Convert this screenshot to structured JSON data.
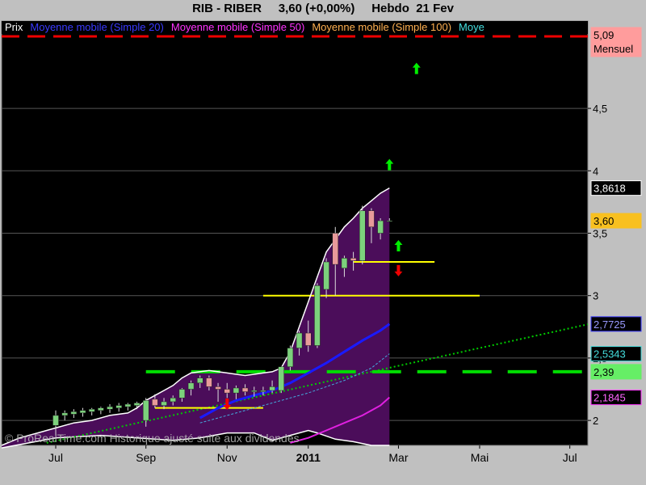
{
  "header": {
    "title": "RIB - RIBER     3,60 (+0,00%)     Hebdo  21 Fev"
  },
  "colors": {
    "background": "#c0c0c0",
    "plot_bg": "#000000",
    "fill_area": "#4b0d5a",
    "up_candle": "#7cd17c",
    "down_candle": "#e89a9a",
    "price_line": "#ffffff",
    "ma20": "#1a1aff",
    "ma50": "#e020e0",
    "ma100": "#ffb050",
    "trend": "#00cc00",
    "support": "#ffff00",
    "dashed": "#00dd00"
  },
  "chart_data": {
    "type": "candlestick",
    "title": "RIB - RIBER     3,60 (+0,00%)     Hebdo  21 Fev",
    "legend": [
      {
        "name": "Prix",
        "color": "#ffffff"
      },
      {
        "name": "Moyenne mobile (Simple 20)",
        "color": "#3a3aff"
      },
      {
        "name": "Moyenne mobile (Simple 50)",
        "color": "#ff33ff"
      },
      {
        "name": "Moyenne mobile (Simple 100)",
        "color": "#ffb050"
      },
      {
        "name": "Moye",
        "color": "#44dddd"
      }
    ],
    "x_ticks": [
      {
        "label": "Jul",
        "i": 0,
        "bold": false
      },
      {
        "label": "Sep",
        "i": 10,
        "bold": false
      },
      {
        "label": "Nov",
        "i": 19,
        "bold": false
      },
      {
        "label": "2011",
        "i": 28,
        "bold": true
      },
      {
        "label": "Mar",
        "i": 38,
        "bold": false
      },
      {
        "label": "Mai",
        "i": 47,
        "bold": false
      },
      {
        "label": "Jul",
        "i": 57,
        "bold": false
      }
    ],
    "y_ticks": [
      "2",
      "2,5",
      "3",
      "3,5",
      "4",
      "4,5"
    ],
    "y_tick_values": [
      2,
      2.5,
      3,
      3.5,
      4,
      4.5
    ],
    "ylim": [
      1.8,
      5.2
    ],
    "xlim": [
      -6,
      59
    ],
    "candles": [
      {
        "i": 0,
        "o": 1.96,
        "h": 2.08,
        "l": 1.88,
        "c": 2.04
      },
      {
        "i": 1,
        "o": 2.04,
        "h": 2.08,
        "l": 2.0,
        "c": 2.06
      },
      {
        "i": 2,
        "o": 2.05,
        "h": 2.09,
        "l": 2.02,
        "c": 2.07
      },
      {
        "i": 3,
        "o": 2.06,
        "h": 2.1,
        "l": 2.03,
        "c": 2.08
      },
      {
        "i": 4,
        "o": 2.07,
        "h": 2.1,
        "l": 2.04,
        "c": 2.09
      },
      {
        "i": 5,
        "o": 2.08,
        "h": 2.11,
        "l": 2.05,
        "c": 2.1
      },
      {
        "i": 6,
        "o": 2.09,
        "h": 2.13,
        "l": 2.06,
        "c": 2.11
      },
      {
        "i": 7,
        "o": 2.1,
        "h": 2.14,
        "l": 2.07,
        "c": 2.12
      },
      {
        "i": 8,
        "o": 2.11,
        "h": 2.14,
        "l": 2.08,
        "c": 2.13
      },
      {
        "i": 9,
        "o": 2.12,
        "h": 2.15,
        "l": 2.09,
        "c": 2.14
      },
      {
        "i": 10,
        "o": 2.0,
        "h": 2.18,
        "l": 1.95,
        "c": 2.16
      },
      {
        "i": 11,
        "o": 2.17,
        "h": 2.21,
        "l": 2.1,
        "c": 2.12
      },
      {
        "i": 12,
        "o": 2.12,
        "h": 2.18,
        "l": 2.09,
        "c": 2.15
      },
      {
        "i": 13,
        "o": 2.15,
        "h": 2.2,
        "l": 2.12,
        "c": 2.18
      },
      {
        "i": 14,
        "o": 2.18,
        "h": 2.26,
        "l": 2.15,
        "c": 2.25
      },
      {
        "i": 15,
        "o": 2.25,
        "h": 2.32,
        "l": 2.2,
        "c": 2.3
      },
      {
        "i": 16,
        "o": 2.3,
        "h": 2.36,
        "l": 2.26,
        "c": 2.34
      },
      {
        "i": 17,
        "o": 2.34,
        "h": 2.36,
        "l": 2.24,
        "c": 2.27
      },
      {
        "i": 18,
        "o": 2.27,
        "h": 2.3,
        "l": 2.15,
        "c": 2.25
      },
      {
        "i": 19,
        "o": 2.25,
        "h": 2.3,
        "l": 2.18,
        "c": 2.22
      },
      {
        "i": 20,
        "o": 2.22,
        "h": 2.28,
        "l": 2.17,
        "c": 2.26
      },
      {
        "i": 21,
        "o": 2.26,
        "h": 2.29,
        "l": 2.2,
        "c": 2.23
      },
      {
        "i": 22,
        "o": 2.23,
        "h": 2.27,
        "l": 2.19,
        "c": 2.24
      },
      {
        "i": 23,
        "o": 2.23,
        "h": 2.27,
        "l": 2.2,
        "c": 2.24
      },
      {
        "i": 24,
        "o": 2.24,
        "h": 2.32,
        "l": 2.22,
        "c": 2.27
      },
      {
        "i": 25,
        "o": 2.24,
        "h": 2.43,
        "l": 2.22,
        "c": 2.43
      },
      {
        "i": 26,
        "o": 2.43,
        "h": 2.6,
        "l": 2.4,
        "c": 2.58
      },
      {
        "i": 27,
        "o": 2.58,
        "h": 2.72,
        "l": 2.52,
        "c": 2.7
      },
      {
        "i": 28,
        "o": 2.7,
        "h": 2.8,
        "l": 2.55,
        "c": 2.6
      },
      {
        "i": 29,
        "o": 2.6,
        "h": 3.1,
        "l": 2.58,
        "c": 3.08
      },
      {
        "i": 30,
        "o": 3.05,
        "h": 3.3,
        "l": 2.98,
        "c": 3.27
      },
      {
        "i": 31,
        "o": 3.5,
        "h": 3.55,
        "l": 3.0,
        "c": 3.25
      },
      {
        "i": 32,
        "o": 3.22,
        "h": 3.32,
        "l": 3.15,
        "c": 3.3
      },
      {
        "i": 33,
        "o": 3.3,
        "h": 3.35,
        "l": 3.2,
        "c": 3.28
      },
      {
        "i": 34,
        "o": 3.28,
        "h": 3.72,
        "l": 3.25,
        "c": 3.68
      },
      {
        "i": 35,
        "o": 3.68,
        "h": 3.7,
        "l": 3.42,
        "c": 3.55
      },
      {
        "i": 36,
        "o": 3.5,
        "h": 3.62,
        "l": 3.45,
        "c": 3.6
      },
      {
        "i": 37,
        "o": 3.6,
        "h": 3.62,
        "l": 3.6,
        "c": 3.6
      }
    ],
    "price_line": [
      [
        -6,
        1.8
      ],
      [
        -4,
        1.86
      ],
      [
        -2,
        1.9
      ],
      [
        0,
        1.94
      ],
      [
        2,
        1.98
      ],
      [
        4,
        2.0
      ],
      [
        6,
        2.04
      ],
      [
        8,
        2.06
      ],
      [
        9,
        2.1
      ],
      [
        10,
        2.16
      ],
      [
        11,
        2.2
      ],
      [
        12,
        2.24
      ],
      [
        13,
        2.28
      ],
      [
        14,
        2.34
      ],
      [
        15,
        2.38
      ],
      [
        16,
        2.39
      ],
      [
        17,
        2.4
      ],
      [
        18,
        2.39
      ],
      [
        19,
        2.38
      ],
      [
        20,
        2.37
      ],
      [
        21,
        2.36
      ],
      [
        22,
        2.37
      ],
      [
        23,
        2.38
      ],
      [
        24,
        2.39
      ],
      [
        25,
        2.42
      ],
      [
        26,
        2.55
      ],
      [
        27,
        2.75
      ],
      [
        28,
        2.95
      ],
      [
        29,
        3.15
      ],
      [
        30,
        3.35
      ],
      [
        31,
        3.45
      ],
      [
        32,
        3.55
      ],
      [
        33,
        3.62
      ],
      [
        34,
        3.7
      ],
      [
        35,
        3.76
      ],
      [
        36,
        3.82
      ],
      [
        37,
        3.8618
      ]
    ],
    "lower_envelope": [
      [
        -6,
        1.78
      ],
      [
        0,
        1.86
      ],
      [
        5,
        1.88
      ],
      [
        9,
        1.86
      ],
      [
        13,
        1.84
      ],
      [
        16,
        1.86
      ],
      [
        19,
        1.9
      ],
      [
        22,
        1.9
      ],
      [
        24,
        1.84
      ],
      [
        26,
        1.88
      ],
      [
        28,
        1.92
      ],
      [
        29,
        1.9
      ],
      [
        31,
        1.85
      ],
      [
        33,
        1.83
      ],
      [
        35,
        1.8
      ],
      [
        37,
        1.8
      ]
    ],
    "ma20": [
      [
        16,
        2.02
      ],
      [
        18,
        2.1
      ],
      [
        20,
        2.16
      ],
      [
        22,
        2.2
      ],
      [
        24,
        2.24
      ],
      [
        26,
        2.3
      ],
      [
        28,
        2.38
      ],
      [
        30,
        2.46
      ],
      [
        32,
        2.55
      ],
      [
        34,
        2.64
      ],
      [
        36,
        2.72
      ],
      [
        37,
        2.7725
      ]
    ],
    "ma50": [
      [
        26,
        1.82
      ],
      [
        28,
        1.86
      ],
      [
        30,
        1.92
      ],
      [
        32,
        1.98
      ],
      [
        34,
        2.04
      ],
      [
        36,
        2.12
      ],
      [
        37,
        2.1845
      ]
    ],
    "ma_cyan": [
      [
        16,
        1.98
      ],
      [
        20,
        2.06
      ],
      [
        24,
        2.14
      ],
      [
        28,
        2.22
      ],
      [
        32,
        2.32
      ],
      [
        35,
        2.42
      ],
      [
        37,
        2.5343
      ]
    ],
    "trendline": [
      [
        -1,
        1.82
      ],
      [
        59,
        2.77
      ]
    ],
    "dashed_level": {
      "y": 2.39,
      "x1": 10,
      "x2": 59
    },
    "support_lines": [
      {
        "y": 2.1,
        "x1": 11,
        "x2": 23
      },
      {
        "y": 3.0,
        "x1": 23,
        "x2": 47
      },
      {
        "y": 3.27,
        "x1": 33,
        "x2": 42
      }
    ],
    "arrows": [
      {
        "dir": "up",
        "i": 40,
        "y": 4.82,
        "color": "#00ee00"
      },
      {
        "dir": "up",
        "i": 37,
        "y": 4.05,
        "color": "#00ee00"
      },
      {
        "dir": "up",
        "i": 38,
        "y": 3.4,
        "color": "#00ee00"
      },
      {
        "dir": "down",
        "i": 38,
        "y": 3.2,
        "color": "#ee0000"
      },
      {
        "dir": "down",
        "i": 19,
        "y": 2.13,
        "color": "#ee0000"
      }
    ],
    "right_labels": [
      {
        "text": "5,09",
        "text2": "Mensuel",
        "y": 5.09,
        "bg": "#ff9c9c",
        "fg": "#000000",
        "border": "#ff9c9c"
      },
      {
        "text": "3,8618",
        "y": 3.8618,
        "bg": "#000000",
        "fg": "#ffffff",
        "border": "#ffffff"
      },
      {
        "text": "3,60",
        "y": 3.6,
        "bg": "#f8c020",
        "fg": "#000000",
        "border": "#f8c020"
      },
      {
        "text": "2,7725",
        "y": 2.7725,
        "bg": "#000000",
        "fg": "#9a9aff",
        "border": "#3a3aff"
      },
      {
        "text": "2,5343",
        "y": 2.5343,
        "bg": "#000000",
        "fg": "#44dddd",
        "border": "#44dddd"
      },
      {
        "text": "2,39",
        "y": 2.39,
        "bg": "#66ee66",
        "fg": "#000000",
        "border": "#66ee66"
      },
      {
        "text": "2,1845",
        "y": 2.1845,
        "bg": "#000000",
        "fg": "#ff66ff",
        "border": "#ff33ff"
      }
    ],
    "watermark": "© ProRealTime.com Historique ajusté suite aux dividendes"
  }
}
